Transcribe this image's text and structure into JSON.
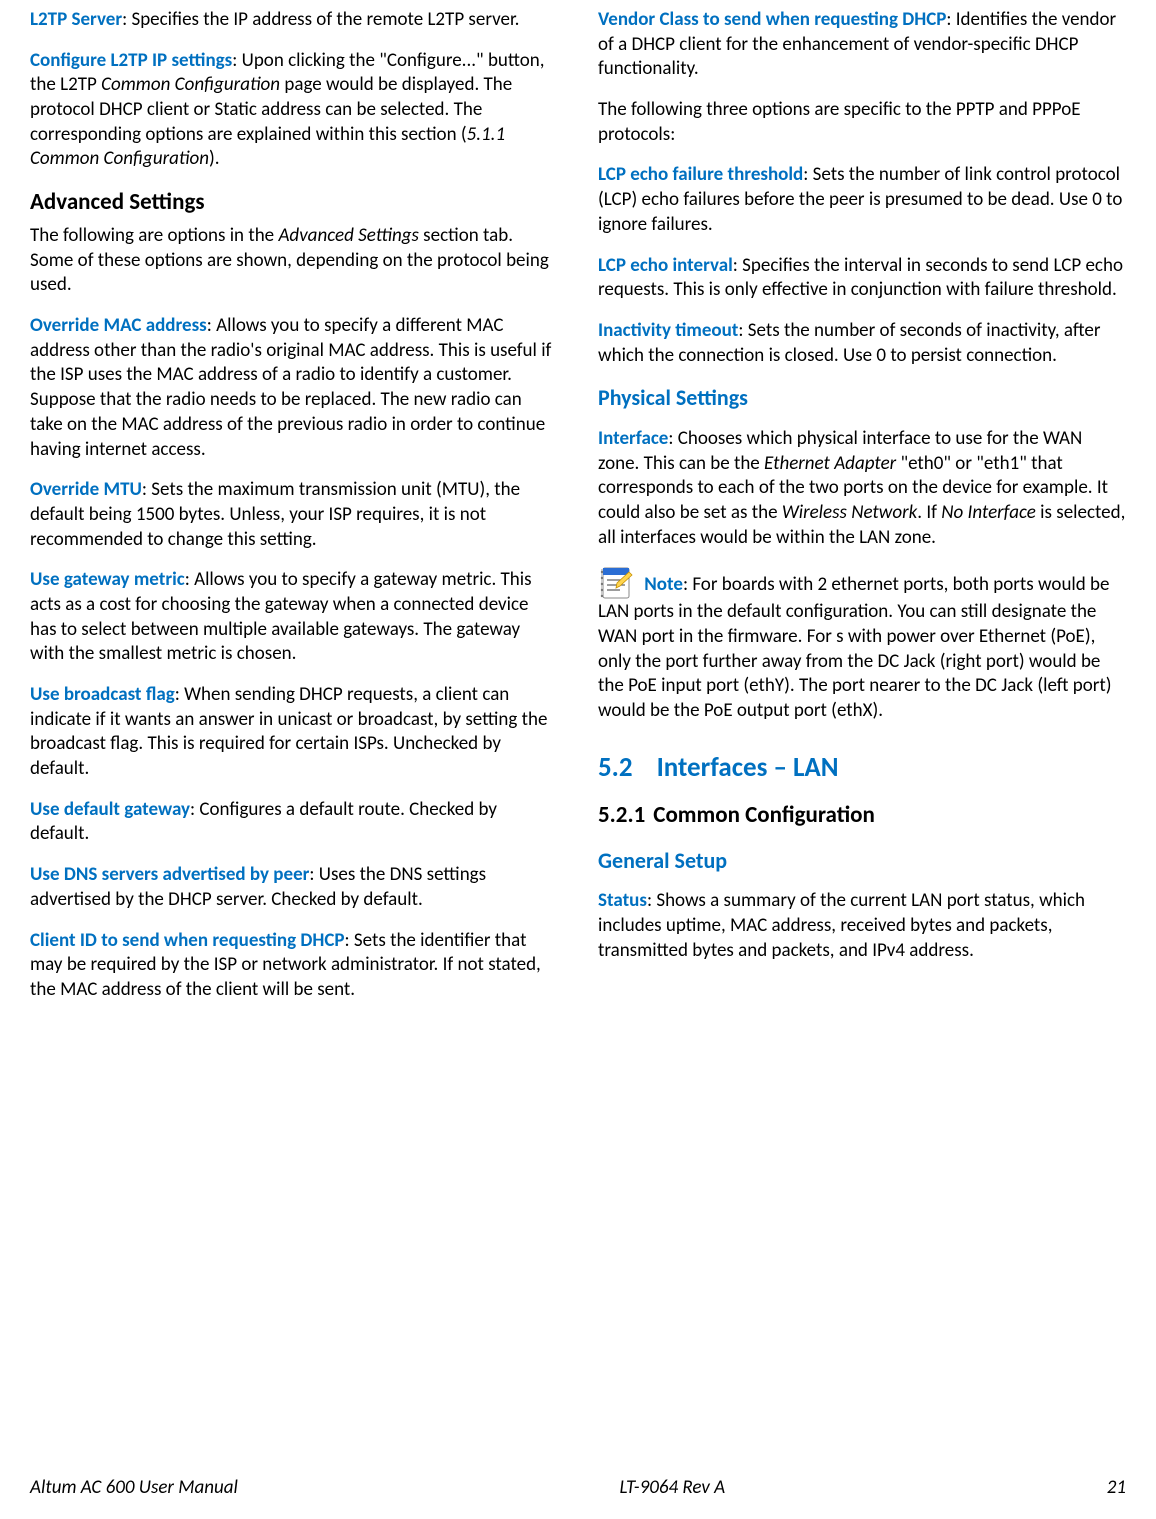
{
  "left": {
    "l2tp_server": {
      "term": "L2TP Server",
      "text": ": Specifies the IP address of the remote L2TP server."
    },
    "configure_l2tp": {
      "term": "Configure L2TP IP settings",
      "pre": ": Upon clicking the \"Configure...\" button, the L2TP ",
      "em1": "Common Configuration",
      "mid": " page would be displayed. The protocol DHCP client or Static address can be selected. The corresponding options are explained within this section (",
      "em2": "5.1.1    Common Configuration",
      "post": ")."
    },
    "advanced_heading": "Advanced Settings",
    "advanced_intro": {
      "pre": "The following are options in the ",
      "em": "Advanced Settings",
      "post": " section tab. Some of these options are shown, depending on the protocol being used."
    },
    "override_mac": {
      "term": "Override MAC address",
      "text": ": Allows you to specify a different MAC address other than the radio's original MAC address. This is useful if the ISP uses the MAC address of a radio to identify a customer. Suppose that the radio needs to be replaced. The new radio can take on the MAC address of the previous radio in order to continue having internet access."
    },
    "override_mtu": {
      "term": "Override MTU",
      "text": ": Sets the maximum transmission unit (MTU), the default being 1500 bytes. Unless, your ISP requires, it is not recommended to change this setting."
    },
    "gateway_metric": {
      "term": "Use gateway metric",
      "text": ": Allows you to specify a gateway metric. This acts as a cost for choosing the gateway when a connected device has to select between multiple available gateways. The gateway with the smallest metric is chosen."
    },
    "broadcast_flag": {
      "term": "Use broadcast flag",
      "text": ": When sending DHCP requests, a client can indicate if it wants an answer in unicast or broadcast, by setting the broadcast flag. This is required for certain ISPs. Unchecked by default."
    },
    "default_gateway": {
      "term": "Use default gateway",
      "text": ": Configures a default route. Checked by default."
    },
    "dns_peer": {
      "term": "Use DNS servers advertised by peer",
      "text": ": Uses the DNS settings advertised by the DHCP server. Checked by default."
    },
    "client_id": {
      "term": "Client ID to send when requesting DHCP",
      "text": ": Sets the identifier that may be required by the ISP or network administrator. If not stated, the MAC address of the client will be sent."
    }
  },
  "right": {
    "vendor_class": {
      "term": "Vendor Class to send when requesting DHCP",
      "text": ": Identifies the vendor of a DHCP client for the enhancement of vendor-specific DHCP functionality."
    },
    "three_options": "The following three options are specific to the PPTP and PPPoE protocols:",
    "lcp_failure": {
      "term": "LCP echo failure threshold",
      "text": ": Sets the number of link control protocol (LCP) echo failures before the peer is presumed to be dead. Use 0 to ignore failures."
    },
    "lcp_interval": {
      "term": "LCP echo interval",
      "text": ": Specifies the interval in seconds to send LCP echo requests. This is only effective in conjunction with failure threshold."
    },
    "inactivity": {
      "term": "Inactivity timeout",
      "text": ": Sets the number of seconds of inactivity, after which the connection is closed. Use 0 to persist connection."
    },
    "physical_heading": "Physical Settings",
    "interface": {
      "term": "Interface",
      "pre": ": Chooses which physical interface to use for the WAN zone. This can be the ",
      "em1": "Ethernet Adapter",
      "mid1": " \"eth0\" or \"eth1\" that corresponds to each of the two ports on the device for example. It could also be set as the ",
      "em2": "Wireless Network",
      "mid2": ". If ",
      "em3": "No Interface",
      "post": " is selected, all interfaces would be within the LAN zone."
    },
    "note": {
      "term": "Note",
      "text": ": For boards with 2 ethernet ports, both ports would be LAN ports in the default configuration. You can still designate the WAN port in the firmware. For s with power over Ethernet (PoE), only the port further away from the DC Jack (right port) would be the PoE input port (ethY). The port nearer to the DC Jack (left port) would be the PoE output port (ethX)."
    },
    "section_52": {
      "num": "5.2",
      "title": "Interfaces – LAN"
    },
    "section_521": {
      "num": "5.2.1",
      "title": "Common Configuration"
    },
    "general_setup": "General Setup",
    "status": {
      "term": "Status",
      "text": ": Shows a summary of the current LAN port status, which includes uptime, MAC address, received bytes and packets, transmitted bytes and packets, and IPv4 address."
    }
  },
  "footer": {
    "left": "Altum AC 600 User Manual",
    "center": "LT-9064 Rev A",
    "right": "21"
  }
}
